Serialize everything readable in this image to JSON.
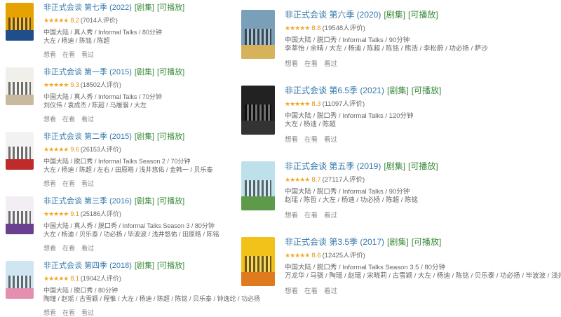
{
  "colors": {
    "link": "#3377aa",
    "tag": "#3a8a3a",
    "star": "#f5a623",
    "muted": "#666666"
  },
  "left": [
    {
      "name": "非正式会谈 第七季 (2022)",
      "tags": [
        "[剧集]",
        "[可播放]"
      ],
      "score": "8.2",
      "votes": "(7014人评价)",
      "meta": [
        "中国大陆 / 真人秀 / Informal Talks / 80分钟",
        "大左 / 杨迪 / 陈铭 / 陈超"
      ],
      "actions": [
        "想看",
        "在看",
        "看过"
      ],
      "poster": {
        "top": "#e6a200",
        "band": "#1f4f8a"
      }
    },
    {
      "name": "非正式会谈 第一季 (2015)",
      "tags": [
        "[剧集]",
        "[可播放]"
      ],
      "score": "9.3",
      "votes": "(18502人评价)",
      "meta": [
        "中国大陆 / 真人秀 / Informal Talks / 70分钟",
        "刘仪伟 / 袁成杰 / 陈超 / 马履骥 / 大左"
      ],
      "actions": [
        "想看",
        "在看",
        "看过"
      ],
      "poster": {
        "top": "#f0efe9",
        "band": "#c9b9a0"
      }
    },
    {
      "name": "非正式会谈 第二季 (2015)",
      "tags": [
        "[剧集]",
        "[可播放]"
      ],
      "score": "9.6",
      "votes": "(26153人评价)",
      "meta": [
        "中国大陆 / 脱口秀 / Informal Talks Season 2 / 70分钟",
        "大左 / 杨迪 / 陈超 / 左右 / 田原皓 / 浅井悠佑 / 金韩一 / 贝乐泰"
      ],
      "actions": [
        "想看",
        "在看",
        "看过"
      ],
      "poster": {
        "top": "#f2f2f2",
        "band": "#bf2b2b"
      }
    },
    {
      "name": "非正式会谈 第三季 (2016)",
      "tags": [
        "[剧集]",
        "[可播放]"
      ],
      "score": "9.1",
      "votes": "(25186人评价)",
      "meta": [
        "中国大陆 / 真人秀 / 脱口秀 / Informal Talks Season 3 / 80分钟",
        "大左 / 杨迪 / 贝乐泰 / 功必扬 / 毕波波 / 浅井悠佑 / 田原皓 / 陈铭"
      ],
      "actions": [
        "想看",
        "在看",
        "看过"
      ],
      "poster": {
        "top": "#f3eef4",
        "band": "#6a3f8f"
      }
    },
    {
      "name": "非正式会谈 第四季 (2018)",
      "tags": [
        "[剧集]",
        "[可播放]"
      ],
      "score": "8.1",
      "votes": "(19042人评价)",
      "meta": [
        "中国大陆 / 脱口秀 / 80分钟",
        "陶瑾 / 赵瑶 / 古雪颖 / 程惟 / 大左 / 杨迪 / 陈超 / 陈铭 / 贝乐泰 / 钟逸纶 / 功必扬"
      ],
      "actions": [
        "想看",
        "在看",
        "看过"
      ],
      "poster": {
        "top": "#cfe6f2",
        "band": "#e58fb0"
      }
    }
  ],
  "right": [
    {
      "name": "非正式会谈 第六季 (2020)",
      "tags": [
        "[剧集]",
        "[可播放]"
      ],
      "score": "8.8",
      "votes": "(19548人评价)",
      "meta": [
        "中国大陆 / 脱口秀 / Informal Talks / 90分钟",
        "李莘怡 / 余晴 / 大左 / 杨迪 / 陈超 / 陈铭 / 熊浩 / 李松蔚 / 功必扬 / 萨沙"
      ],
      "actions": [
        "想看",
        "在看",
        "看过"
      ],
      "poster": {
        "top": "#7a9fb8",
        "band": "#d6b25a"
      }
    },
    {
      "name": "非正式会谈 第6.5季 (2021)",
      "tags": [
        "[剧集]",
        "[可播放]"
      ],
      "score": "8.3",
      "votes": "(11097人评价)",
      "meta": [
        "中国大陆 / 脱口秀 / Informal Talks / 120分钟",
        "大左 / 杨迪 / 陈超"
      ],
      "actions": [
        "想看",
        "在看",
        "看过"
      ],
      "poster": {
        "top": "#222222",
        "band": "#333333"
      }
    },
    {
      "name": "非正式会谈 第五季 (2019)",
      "tags": [
        "[剧集]",
        "[可播放]"
      ],
      "score": "8.7",
      "votes": "(27117人评价)",
      "meta": [
        "中国大陆 / 脱口秀 / Informal Talks / 90分钟",
        "赵瑶 / 陈哲 / 大左 / 杨迪 / 功必扬 / 陈超 / 陈铭"
      ],
      "actions": [
        "想看",
        "在看",
        "看过"
      ],
      "poster": {
        "top": "#bde0ea",
        "band": "#5d9a4a"
      }
    },
    {
      "name": "非正式会谈 第3.5季 (2017)",
      "tags": [
        "[剧集]",
        "[可播放]"
      ],
      "score": "8.6",
      "votes": "(12425人评价)",
      "meta": [
        "中国大陆 / 脱口秀 / Informal Talks Season 3.5 / 80分钟",
        "万龙华 / 马骁 / 陶瑶 / 赵瑶 / 宋晓莉 / 古雪颖 / 大左 / 杨迪 / 陈铭 / 贝乐泰 / 功必扬 / 毕波波 / 浅井悠佑"
      ],
      "actions": [
        "想看",
        "在看",
        "看过"
      ],
      "poster": {
        "top": "#f3c21a",
        "band": "#e07a1f"
      }
    }
  ]
}
